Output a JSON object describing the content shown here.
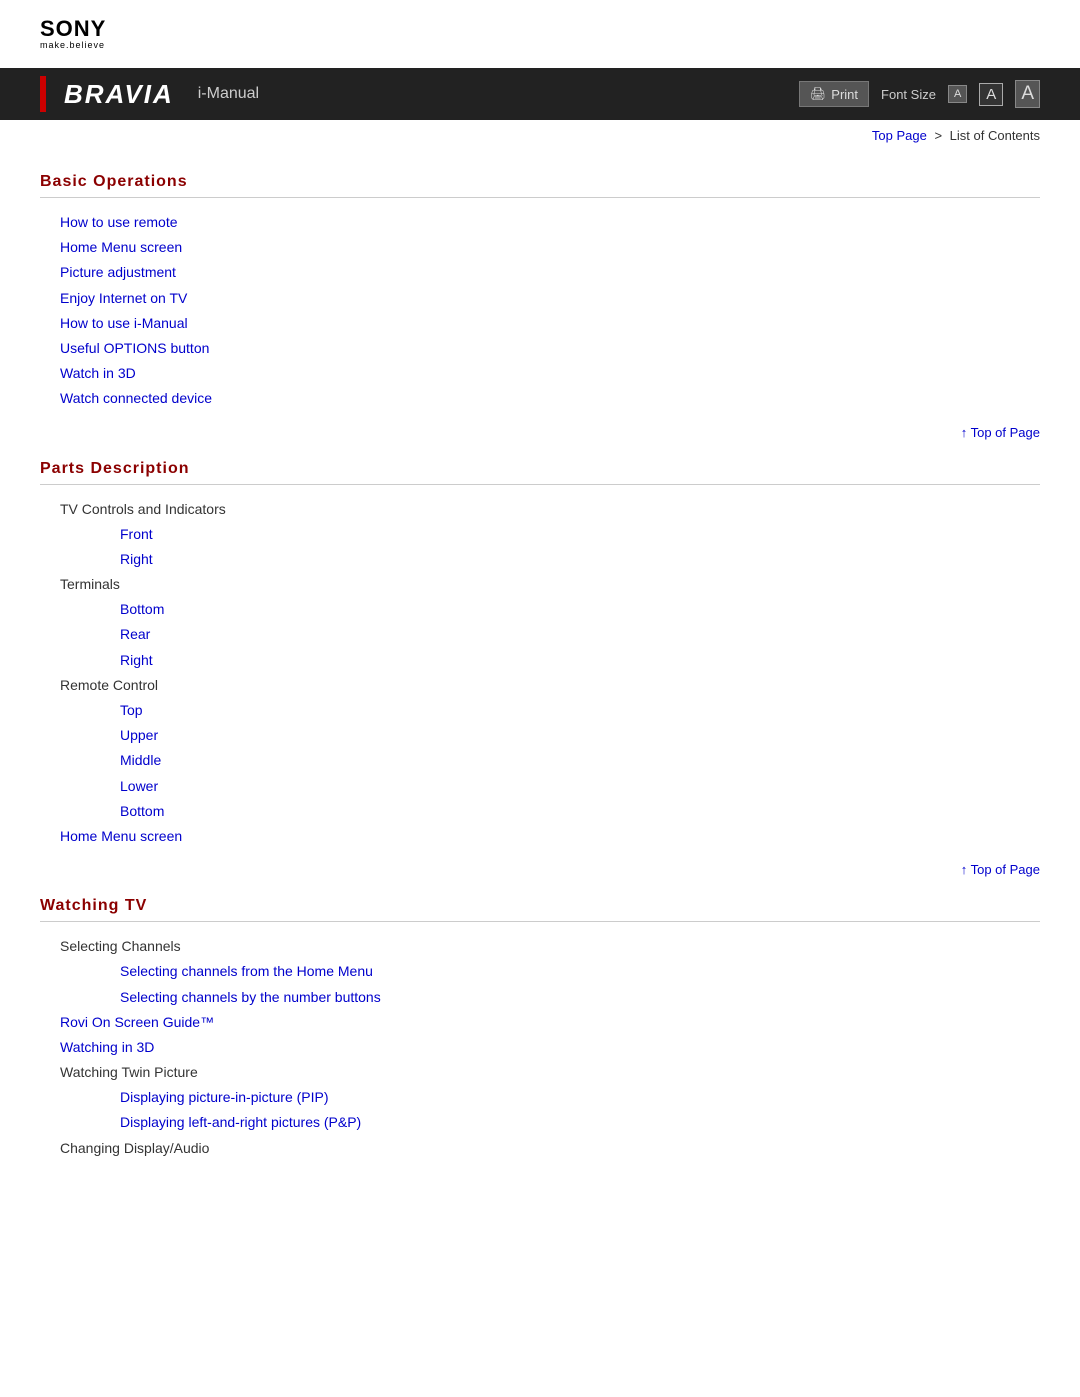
{
  "logo": {
    "brand": "SONY",
    "tagline": "make.believe"
  },
  "header": {
    "bravia": "BRAVIA",
    "imanual": "i-Manual",
    "print_label": "Print",
    "font_size_label": "Font Size",
    "font_small": "A",
    "font_medium": "A",
    "font_large": "A"
  },
  "breadcrumb": {
    "top_page": "Top Page",
    "separator": ">",
    "current": "List of Contents"
  },
  "sections": [
    {
      "id": "basic-operations",
      "heading": "Basic Operations",
      "items": [
        {
          "type": "link",
          "indent": 1,
          "label": "How to use remote"
        },
        {
          "type": "link",
          "indent": 1,
          "label": "Home Menu screen"
        },
        {
          "type": "link",
          "indent": 1,
          "label": "Picture adjustment"
        },
        {
          "type": "link",
          "indent": 1,
          "label": "Enjoy Internet on TV"
        },
        {
          "type": "link",
          "indent": 1,
          "label": "How to use i-Manual"
        },
        {
          "type": "link",
          "indent": 1,
          "label": "Useful OPTIONS button"
        },
        {
          "type": "link",
          "indent": 1,
          "label": "Watch in 3D"
        },
        {
          "type": "link",
          "indent": 1,
          "label": "Watch connected device"
        }
      ]
    },
    {
      "id": "parts-description",
      "heading": "Parts Description",
      "items": [
        {
          "type": "plain",
          "indent": 1,
          "label": "TV Controls and Indicators"
        },
        {
          "type": "link",
          "indent": 2,
          "label": "Front"
        },
        {
          "type": "link",
          "indent": 2,
          "label": "Right"
        },
        {
          "type": "plain",
          "indent": 1,
          "label": "Terminals"
        },
        {
          "type": "link",
          "indent": 2,
          "label": "Bottom"
        },
        {
          "type": "link",
          "indent": 2,
          "label": "Rear"
        },
        {
          "type": "link",
          "indent": 2,
          "label": "Right"
        },
        {
          "type": "plain",
          "indent": 1,
          "label": "Remote Control"
        },
        {
          "type": "link",
          "indent": 2,
          "label": "Top"
        },
        {
          "type": "link",
          "indent": 2,
          "label": "Upper"
        },
        {
          "type": "link",
          "indent": 2,
          "label": "Middle"
        },
        {
          "type": "link",
          "indent": 2,
          "label": "Lower"
        },
        {
          "type": "link",
          "indent": 2,
          "label": "Bottom"
        },
        {
          "type": "link",
          "indent": 1,
          "label": "Home Menu screen"
        }
      ]
    },
    {
      "id": "watching-tv",
      "heading": "Watching TV",
      "items": [
        {
          "type": "plain",
          "indent": 1,
          "label": "Selecting Channels"
        },
        {
          "type": "link",
          "indent": 2,
          "label": "Selecting channels from the Home Menu"
        },
        {
          "type": "link",
          "indent": 2,
          "label": "Selecting channels by the number buttons"
        },
        {
          "type": "link",
          "indent": 1,
          "label": "Rovi On Screen Guide™"
        },
        {
          "type": "link",
          "indent": 1,
          "label": "Watching in 3D"
        },
        {
          "type": "plain",
          "indent": 1,
          "label": "Watching Twin Picture"
        },
        {
          "type": "link",
          "indent": 2,
          "label": "Displaying picture-in-picture (PIP)"
        },
        {
          "type": "link",
          "indent": 2,
          "label": "Displaying left-and-right pictures (P&P)"
        },
        {
          "type": "plain",
          "indent": 1,
          "label": "Changing Display/Audio"
        }
      ]
    }
  ],
  "top_of_page": "↑ Top of Page"
}
